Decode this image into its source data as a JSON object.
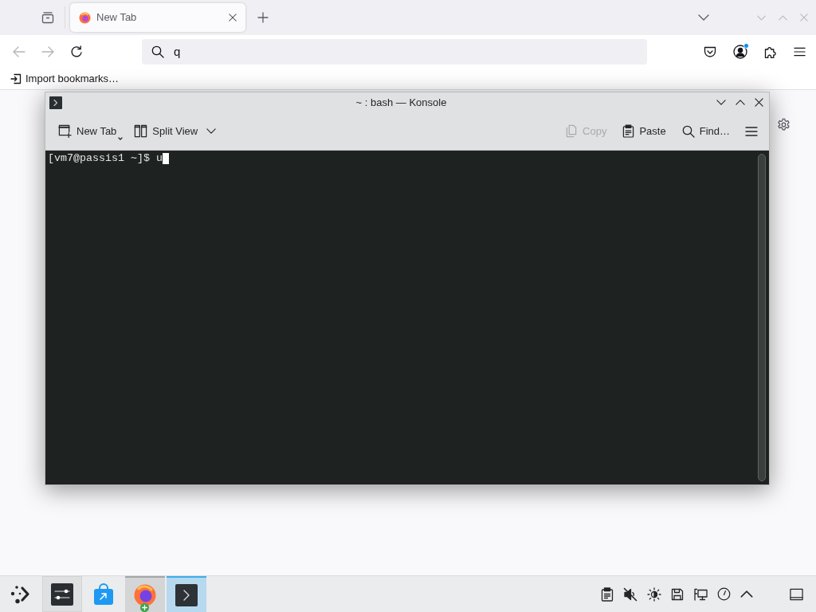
{
  "browser": {
    "tabs": [
      {
        "title": "New Tab",
        "selected": true
      }
    ],
    "navigation": {
      "back_disabled": true,
      "forward_disabled": true
    },
    "address_bar": {
      "value": "q"
    },
    "account_badge": true,
    "bookmarks": [
      {
        "label": "Import bookmarks…"
      }
    ]
  },
  "konsole": {
    "title": "~ : bash — Konsole",
    "toolbar_left": [
      {
        "kind": "new-tab",
        "label": "New Tab",
        "disabled": false
      },
      {
        "kind": "split-view",
        "label": "Split View",
        "disabled": false
      }
    ],
    "toolbar_right": [
      {
        "kind": "copy",
        "label": "Copy",
        "disabled": true
      },
      {
        "kind": "paste",
        "label": "Paste",
        "disabled": false
      },
      {
        "kind": "find",
        "label": "Find…",
        "disabled": false
      }
    ],
    "terminal": {
      "lines": [
        {
          "text": "[vm7@passis1 ~]$ u",
          "cursor": true
        }
      ]
    }
  },
  "taskbar": {
    "apps": [
      {
        "kind": "launcher",
        "active": false,
        "running": false,
        "hovered": false,
        "badge": false
      },
      {
        "kind": "settings",
        "active": false,
        "running": false,
        "hovered": true,
        "badge": false
      },
      {
        "kind": "discover",
        "active": false,
        "running": false,
        "hovered": false,
        "badge": false
      },
      {
        "kind": "web-browser",
        "active": false,
        "running": true,
        "hovered": false,
        "badge": true
      },
      {
        "kind": "terminal",
        "active": true,
        "running": true,
        "hovered": false,
        "badge": false
      }
    ],
    "tray": {
      "muted": true
    }
  }
}
